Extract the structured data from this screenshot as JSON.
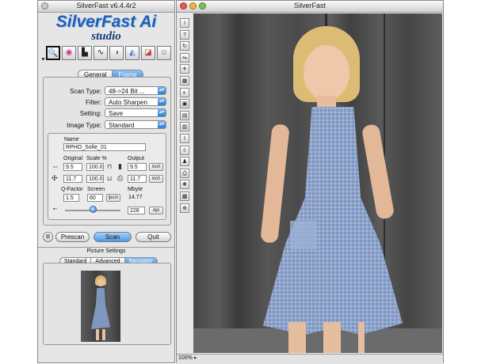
{
  "left_window": {
    "title": "SilverFast v6.4.4r2",
    "brand_line1": "SilverFast Ai",
    "brand_line2": "studio",
    "tools": [
      {
        "icon": "magnifier-icon",
        "glyph": "🔍"
      },
      {
        "icon": "color-wheel-icon",
        "glyph": "◉"
      },
      {
        "icon": "histogram-icon",
        "glyph": "▙"
      },
      {
        "icon": "gradation-curve-icon",
        "glyph": "∿"
      },
      {
        "icon": "global-color-icon",
        "glyph": "◑"
      },
      {
        "icon": "selective-color-icon",
        "glyph": "◭"
      },
      {
        "icon": "usm-icon",
        "glyph": "◪"
      },
      {
        "icon": "expert-icon",
        "glyph": "☺"
      }
    ],
    "tabs": [
      "General",
      "Frame"
    ],
    "active_tab": "Frame",
    "scan_type_label": "Scan Type:",
    "scan_type_value": "48->24 Bit ...",
    "filter_label": "Filter:",
    "filter_value": "Auto Sharpen",
    "setting_label": "Setting:",
    "setting_value": "Save",
    "image_type_label": "Image Type:",
    "image_type_value": "Standard",
    "name_label": "Name",
    "name_value": "RPHO_Sofie_01",
    "original_label": "Original",
    "scale_label": "Scale %",
    "output_label": "Output",
    "orig_w": "9.5",
    "orig_h": "11.7",
    "scale_w": "100.0",
    "scale_h": "100.0",
    "out_w": "9.5",
    "out_h": "11.7",
    "unit_w": "inch",
    "unit_h": "inch",
    "qfactor_label": "Q-Factor",
    "screen_label": "Screen",
    "mbyte_label": "Mbyte",
    "qfactor_value": "1.5",
    "screen_value": "60",
    "screen_unit": "lpcm",
    "mbyte_value": "14.77",
    "resolution_value": "228",
    "resolution_unit": "dpi",
    "resolution_slider_fraction": 0.5,
    "prescan_label": "Prescan",
    "scan_label": "Scan",
    "quit_label": "Quit",
    "picture_settings_label": "Picture Settings",
    "ps_tabs": [
      "Standard",
      "Advanced",
      "Navigator"
    ],
    "ps_active_tab": "Navigator"
  },
  "right_window": {
    "title": "SilverFast",
    "zoom_value": "100%",
    "side_tools": [
      {
        "icon": "info-icon",
        "glyph": "i"
      },
      {
        "icon": "help-icon",
        "glyph": "?"
      },
      {
        "icon": "rotate-icon",
        "glyph": "↻"
      },
      {
        "icon": "flip-icon",
        "glyph": "⇋"
      },
      {
        "icon": "plane-icon",
        "glyph": "✈"
      },
      {
        "icon": "grid-icon",
        "glyph": "▦"
      },
      {
        "icon": "invert-icon",
        "glyph": "◐"
      },
      {
        "icon": "frame-icon",
        "glyph": "▣"
      },
      {
        "icon": "multi-frame-icon",
        "glyph": "▤"
      },
      {
        "icon": "swatch-icon",
        "glyph": "▥"
      },
      {
        "icon": "dropper-icon",
        "glyph": "⌇"
      },
      {
        "icon": "densitometer-icon",
        "glyph": "◊"
      },
      {
        "icon": "stamp-icon",
        "glyph": "♟"
      },
      {
        "icon": "printer-icon",
        "glyph": "⎙"
      },
      {
        "icon": "color-manage-icon",
        "glyph": "❖"
      },
      {
        "icon": "jpeg-icon",
        "glyph": "▩"
      },
      {
        "icon": "zoom-icon",
        "glyph": "⊕"
      }
    ]
  }
}
